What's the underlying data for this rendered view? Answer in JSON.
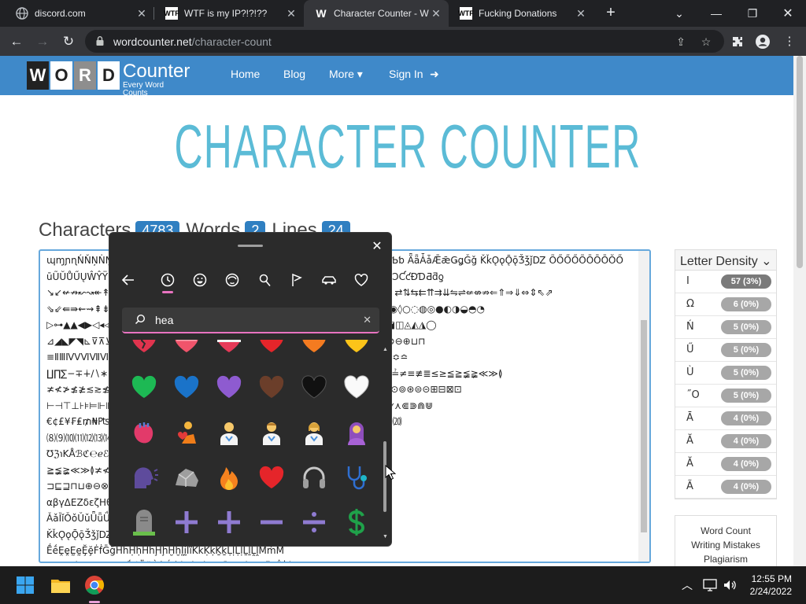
{
  "browser": {
    "tabs": [
      {
        "title": "discord.com",
        "favicon": "globe-icon"
      },
      {
        "title": "WTF is my IP?!?!??",
        "favicon": "WTF"
      },
      {
        "title": "Character Counter - W",
        "favicon": "W"
      },
      {
        "title": "Fucking Donations",
        "favicon": "WTF"
      }
    ],
    "url_domain": "wordcounter.net",
    "url_path": "/character-count"
  },
  "site": {
    "logo_letters": [
      "W",
      "O",
      "R",
      "D"
    ],
    "logo_title": "Counter",
    "logo_tagline": "Every Word Counts",
    "nav": [
      {
        "label": "Home"
      },
      {
        "label": "Blog"
      },
      {
        "label": "More ▾"
      },
      {
        "label": "Sign In"
      }
    ],
    "page_title": "CHARACTER COUNTER"
  },
  "counts": {
    "characters_label": "Characters",
    "characters": "4783",
    "words_label": "Words",
    "words": "2",
    "lines_label": "Lines",
    "lines": "24"
  },
  "textarea": {
    "content": "ɰɱɲɳŃŇŅṄṆṈṊ ɐɑɒɓɔɕɖɗɘəɚɛ ɜɝɞɟɠɡɢɣɤ ŖŗŘřŠšŢţŤťŦŧ ŤŸŹźŻżŽžƀƁƂƃƄƅ ǞǟǠǡǢǣǤǥǦǧ ǨǩǪǫǬǭǮǯǰǱ ÕŐŐŐÕŌŌŌŎŐ\nūŨŬŮŰŲŴŶŸƂƅƆƇƈƉƊƋƌƍƎƏƐƑƒƓƔ ꜰꜱꜲꜳꜴꜵꜶꜷꜸꜹ ŸŹźŻżŽž ƀƁƂƃ ƄƅƆƇƈƉƊƋƌƍ\n↘↙↚↛↜↝↞↟↠↡↢↣↤↥↦↧↨↩↪↫↬↭↮↯↰↱↲↳↴↵↶↷↸↹↺↻↼↽↾↿⇀⇁⇂⇃⇄⇅⇆⇇⇈⇉⇊⇋⇌⇍⇎⇏⇐⇑⇒⇓⇔⇕⇖⇗\n⇘⇙⇚⇛⇜⇝⇞⇟⇠⇡⇢⇣⇤⇥⇦⇧⇨⇩⇪ ▬▭▮▯▰▱▲△▴▵▶▷▸▹►▻▼▽▾▿◀◁◂◃◄◅◆◇◈◉◊○◌◍◎●◐◑◒◓◔\n▷⊶▲▲◀▶◁◂◃◄◅◆◇◈◉◊○◌◍◎●◐◑◒◓◔◕◖◗◘◙◚◛◜◝◞◟◠◡◢◣◤◥◦◧◨◩◪◫◬◭◮◯\n⊿◢◣◤◥⊾⊽⊼⊻⊺⊹⊸⊷⊶⊵⊴⊳⊲⊱⊰⊯⊮⊭⊬⊫⊪⊩⊨⊧⊦⊥⊤⊣⊢⊡⊠⊟⊞⊝⊜⊛⊚⊙⊘⊗⊖⊕⊔⊓\n≡ⅡⅢⅣⅤⅥⅦⅧⅨⅩⅪⅫⅬⅭⅮⅯ ∰∱∲∳∴∵∶∷∸∹∺∻∼∽∾∿≀≁≂≃≄≅≆≇≈≉≊≋≌≍≎≏\n∐∏∑−∓∔∕∖∗∘∙√∛∜∝∞∟∠∡∢∣∤∥∦∧∨∩∪∫∬∭∮∯ ≐≑≒≓≔≕≖≗≘≙≚≛≜≝≞≟≠≡≢≣≤≥≦≧≨≩≪≫≬\n≭≮≯≰≱≲≳≴≵≶≷≸≹≺≻≼≽≾≿⊀⊁⊂⊃⊄⊅⊆⊇⊈⊉⊊⊋⊌⊍⊎⊏⊐⊑⊒⊓⊔⊕⊖⊗⊘⊙⊚⊛⊜⊝⊞⊟⊠⊡\n⊢⊣⊤⊥⊦⊧⊨⊩⊪⊫⊬⊭⊮⊯⊰⊱⊲⊳⊴⊵⊶⊷⊸⊹⊺⊻⊼⊽⊾⊿⋀⋁⋂⋃⋄⋅⋆⋇⋈⋉⋊⋋⋌⋍⋎⋏⋐⋑⋒⋓\n€¢£¥₣₤₥₦₧₨₩₪₫€₭₮₯₰₱₲₳₴₵ ⑴⑵⑶⑷⑸⑹⑺⑻⑼⑽⑾⑿⒀⒁⒂⒃⒄⒅⒆⒇\n⑻⑼⑽⑾⑿⒀⒁⒂⒃⒄⒅⒆⒇⒈⒉⒊⒋⒌⒍⒎⒏⒐⒑⒒⒓⒔⒕⒖⒗⒘⒙⒚⒛\n℧ℨ℩KÅℬℭ℮ℯℰℱℲℳℴℵℶℷℸ ∮∯∰∱∲∳∴∵∶∷∸∹∺∻∼∽∾∿≀≁≂≃≄≅≆\n≧≨≩≪≫≬≭≮≯≰≱≲≳≴≵≶≷≸≹≺≻≼≽≾≿⊀⊁⊂⊃⊄⊅⊆⊇⊈⊉⊊⊋⊌⊍⊎⊏\n⊐⊑⊒⊓⊔⊕⊖⊗⊘⊙⊚⊛⊜⊝⊞⊟⊠⊡⊢⊣⊤⊥⊦⊧⊨⊩⊪⊫⊬⊭⊮⊯⊰⊱⊲⊳⊴⊵⊶⊷\nαβγΔΕΖδεζΗθΙικΛλΜμΝνΞξΟοΠπΡρΣσςΤτΥυΦφΧχΨψΩω ΑΒΓ\nǍǎǏǐǑǒǓǔǕǖǗǘǙǚǛǜǝǞǟǠǡǢǣǤǥǦǧ ȀȁȂȃȄȅȆȇȈȉȊȋȌȍȎȏȐȑȒȓȔȕ\nǨǩǪǫǬǭǮǯǰǱǲǳǴǵǶǷǸǹǺǻǼǽǾǿ ḀḁḂḃḄḅḆḇḈḉḊḋḌḍḎḏḐḑḒḓḔḕ\nḖḗḘḙḚḛḜḝḞḟḠḡḢḣḤḥḦḧḨḩḪḫḬḭḮḯḰḱḲḳḴḵḶḷḸḹḺḻḼḽḾḿṀ\nṁṂṃṄṅṆṇṈṉṊṋṌṍṎṏṐṑṒṓṔṕṖṗṘṙṚṛṜṝṞṟṠṡṢṣṤṥṦṧṨṩ\nωφΩὨὩὪὫὬὭὮὯὰάὲέὴήὶίὸόὺύὼώᾀᾁᾂᾃᾄᾅᾆᾇ\nςφκϐϖΫΫΫ"
  },
  "letter_density": {
    "title": "Letter Density",
    "rows": [
      {
        "char": "I",
        "count": "57 (3%)",
        "color": "#7a7a7a"
      },
      {
        "char": "Ω",
        "count": "6 (0%)",
        "color": "#a7a7a7"
      },
      {
        "char": "Ń",
        "count": "5 (0%)",
        "color": "#a7a7a7"
      },
      {
        "char": "Ű",
        "count": "5 (0%)",
        "color": "#a7a7a7"
      },
      {
        "char": "Ù",
        "count": "5 (0%)",
        "color": "#a7a7a7"
      },
      {
        "char": "˝O",
        "count": "5 (0%)",
        "color": "#a7a7a7"
      },
      {
        "char": "Ā",
        "count": "4 (0%)",
        "color": "#a7a7a7"
      },
      {
        "char": "Ă",
        "count": "4 (0%)",
        "color": "#a7a7a7"
      },
      {
        "char": "Ă",
        "count": "4 (0%)",
        "color": "#a7a7a7"
      },
      {
        "char": "Ã",
        "count": "4 (0%)",
        "color": "#a7a7a7"
      }
    ]
  },
  "sidebox": {
    "links": [
      "Word Count",
      "Writing Mistakes",
      "Plagiarism"
    ]
  },
  "emoji_panel": {
    "search_query": "hea",
    "categories": [
      "recent-icon",
      "smiley-icon",
      "people-icon",
      "pin-icon",
      "flag-icon",
      "car-icon",
      "heart-icon"
    ]
  },
  "taskbar": {
    "time": "12:55 PM",
    "date": "2/24/2022"
  }
}
